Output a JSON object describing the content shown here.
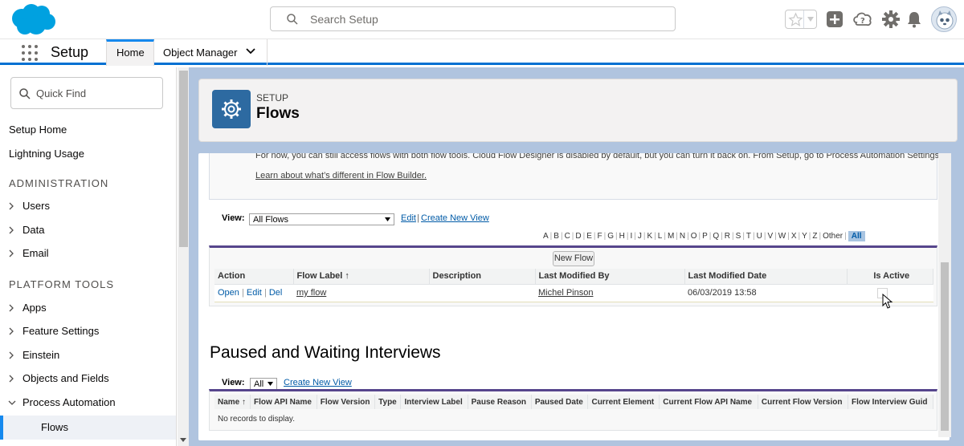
{
  "header": {
    "search_placeholder": "Search Setup"
  },
  "context_bar": {
    "app_name": "Setup",
    "tabs": [
      {
        "label": "Home"
      },
      {
        "label": "Object Manager"
      }
    ]
  },
  "sidebar": {
    "quick_find": "Quick Find",
    "items": [
      "Setup Home",
      "Lightning Usage"
    ],
    "administration": {
      "heading": "ADMINISTRATION",
      "items": [
        "Users",
        "Data",
        "Email"
      ]
    },
    "platform_tools": {
      "heading": "PLATFORM TOOLS",
      "items": [
        "Apps",
        "Feature Settings",
        "Einstein",
        "Objects and Fields",
        "Process Automation"
      ]
    },
    "selected_item": "Flows"
  },
  "page_header": {
    "eyebrow": "SETUP",
    "title": "Flows"
  },
  "message": {
    "text": "For now, you can still access flows with both flow tools. Cloud Flow Designer is disabled by default, but you can turn it back on. From Setup, go to Process Automation Settings.",
    "link": "Learn about what’s different in Flow Builder."
  },
  "flows_view": {
    "label": "View:",
    "selected": "All Flows",
    "edit": "Edit",
    "create": "Create New View"
  },
  "alphabet": [
    "A",
    "B",
    "C",
    "D",
    "E",
    "F",
    "G",
    "H",
    "I",
    "J",
    "K",
    "L",
    "M",
    "N",
    "O",
    "P",
    "Q",
    "R",
    "S",
    "T",
    "U",
    "V",
    "W",
    "X",
    "Y",
    "Z",
    "Other",
    "All"
  ],
  "flows_table": {
    "new_button": "New Flow",
    "columns": [
      "Action",
      "Flow Label ↑",
      "Description",
      "Last Modified By",
      "Last Modified Date",
      "Is Active"
    ],
    "rows": [
      {
        "action_open": "Open",
        "action_edit": "Edit",
        "action_del": "Del",
        "flow_label": "my flow",
        "description": "",
        "last_modified_by": "Michel Pinson",
        "last_modified_date": "06/03/2019 13:58",
        "is_active": false
      }
    ]
  },
  "paused_section": {
    "title": "Paused and Waiting Interviews",
    "view_label": "View:",
    "view_selected": "All",
    "create": "Create New View",
    "columns": [
      "Name ↑",
      "Flow API Name",
      "Flow Version",
      "Type",
      "Interview Label",
      "Pause Reason",
      "Paused Date",
      "Current Element",
      "Current Flow API Name",
      "Current Flow Version",
      "Flow Interview Guid"
    ],
    "empty_text": "No records to display."
  },
  "colors": {
    "brand_blue": "#0070d2",
    "header_icon": "#2d6aa1",
    "list_border": "#56458c",
    "link": "#015ba7"
  }
}
